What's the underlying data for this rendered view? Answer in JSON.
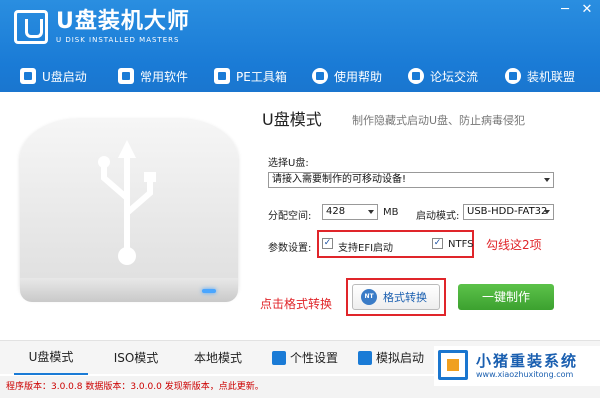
{
  "app": {
    "title": "U盘装机大师",
    "subtitle": "U DISK INSTALLED MASTERS"
  },
  "window_controls": [
    "─",
    "✕"
  ],
  "nav": [
    {
      "label": "U盘启动",
      "icon": "usb-icon"
    },
    {
      "label": "常用软件",
      "icon": "software-icon"
    },
    {
      "label": "PE工具箱",
      "icon": "toolbox-icon"
    },
    {
      "label": "使用帮助",
      "icon": "help-icon"
    },
    {
      "label": "论坛交流",
      "icon": "forum-icon"
    },
    {
      "label": "装机联盟",
      "icon": "users-icon"
    }
  ],
  "mode": {
    "title": "U盘模式",
    "description": "制作隐藏式启动U盘、防止病毒侵犯"
  },
  "form": {
    "select_udisk_label": "选择U盘:",
    "select_udisk_value": "请接入需要制作的可移动设备!",
    "partition_label": "分配空间:",
    "partition_value": "428",
    "partition_unit": "MB",
    "boot_mode_label": "启动模式:",
    "boot_mode_value": "USB-HDD-FAT32",
    "params_label": "参数设置:",
    "efi_label": "支持EFI启动",
    "efi_checked": true,
    "ntfs_label": "NTFS",
    "ntfs_checked": true
  },
  "annotations": {
    "check_two": "勾线这2项",
    "click_format": "点击格式转换"
  },
  "buttons": {
    "format": "格式转换",
    "format_icon_text": "NT",
    "make": "一键制作"
  },
  "tabs": [
    {
      "label": "U盘模式",
      "active": true
    },
    {
      "label": "ISO模式",
      "active": false
    },
    {
      "label": "本地模式",
      "active": false
    },
    {
      "label": "个性设置",
      "active": false
    },
    {
      "label": "模拟启动",
      "active": false
    }
  ],
  "statusbar": {
    "text": "程序版本：3.0.0.8  数据版本：3.0.0.0 发现新版本，点此更新。"
  },
  "watermark": {
    "title": "小猪重装系统",
    "url": "www.xiaozhuxitong.com"
  },
  "colors": {
    "header": "#1a7bd6",
    "accent_green": "#3ca12f",
    "annotation_red": "#e0252a"
  }
}
